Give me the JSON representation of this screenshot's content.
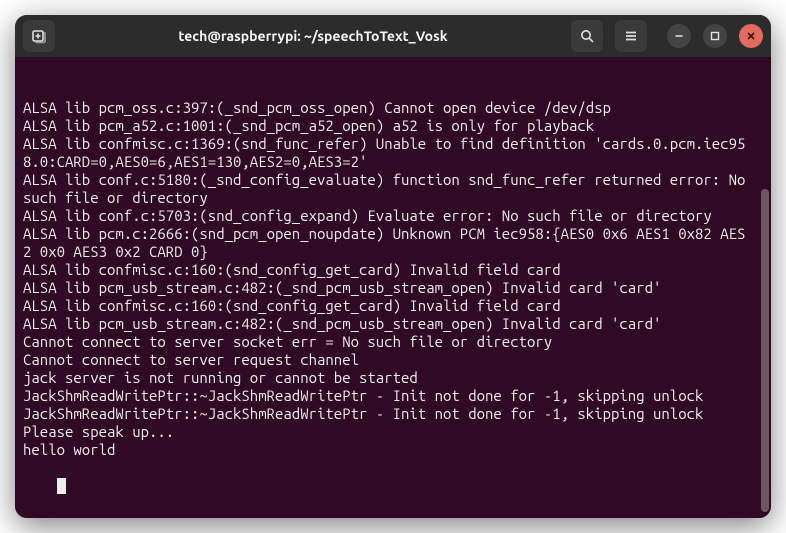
{
  "window": {
    "title": "tech@raspberrypi: ~/speechToText_Vosk"
  },
  "titlebar_icons": {
    "new_tab": "new-tab-icon",
    "search": "search-icon",
    "menu": "hamburger-icon",
    "minimize": "minimize-icon",
    "maximize": "maximize-icon",
    "close": "close-icon"
  },
  "terminal": {
    "lines": [
      "ALSA lib pcm_oss.c:397:(_snd_pcm_oss_open) Cannot open device /dev/dsp",
      "ALSA lib pcm_a52.c:1001:(_snd_pcm_a52_open) a52 is only for playback",
      "ALSA lib confmisc.c:1369:(snd_func_refer) Unable to find definition 'cards.0.pcm.iec958.0:CARD=0,AES0=6,AES1=130,AES2=0,AES3=2'",
      "ALSA lib conf.c:5180:(_snd_config_evaluate) function snd_func_refer returned error: No such file or directory",
      "ALSA lib conf.c:5703:(snd_config_expand) Evaluate error: No such file or directory",
      "ALSA lib pcm.c:2666:(snd_pcm_open_noupdate) Unknown PCM iec958:{AES0 0x6 AES1 0x82 AES2 0x0 AES3 0x2 CARD 0}",
      "ALSA lib confmisc.c:160:(snd_config_get_card) Invalid field card",
      "ALSA lib pcm_usb_stream.c:482:(_snd_pcm_usb_stream_open) Invalid card 'card'",
      "ALSA lib confmisc.c:160:(snd_config_get_card) Invalid field card",
      "ALSA lib pcm_usb_stream.c:482:(_snd_pcm_usb_stream_open) Invalid card 'card'",
      "Cannot connect to server socket err = No such file or directory",
      "Cannot connect to server request channel",
      "jack server is not running or cannot be started",
      "JackShmReadWritePtr::~JackShmReadWritePtr - Init not done for -1, skipping unlock",
      "JackShmReadWritePtr::~JackShmReadWritePtr - Init not done for -1, skipping unlock",
      "Please speak up...",
      "hello world"
    ]
  }
}
